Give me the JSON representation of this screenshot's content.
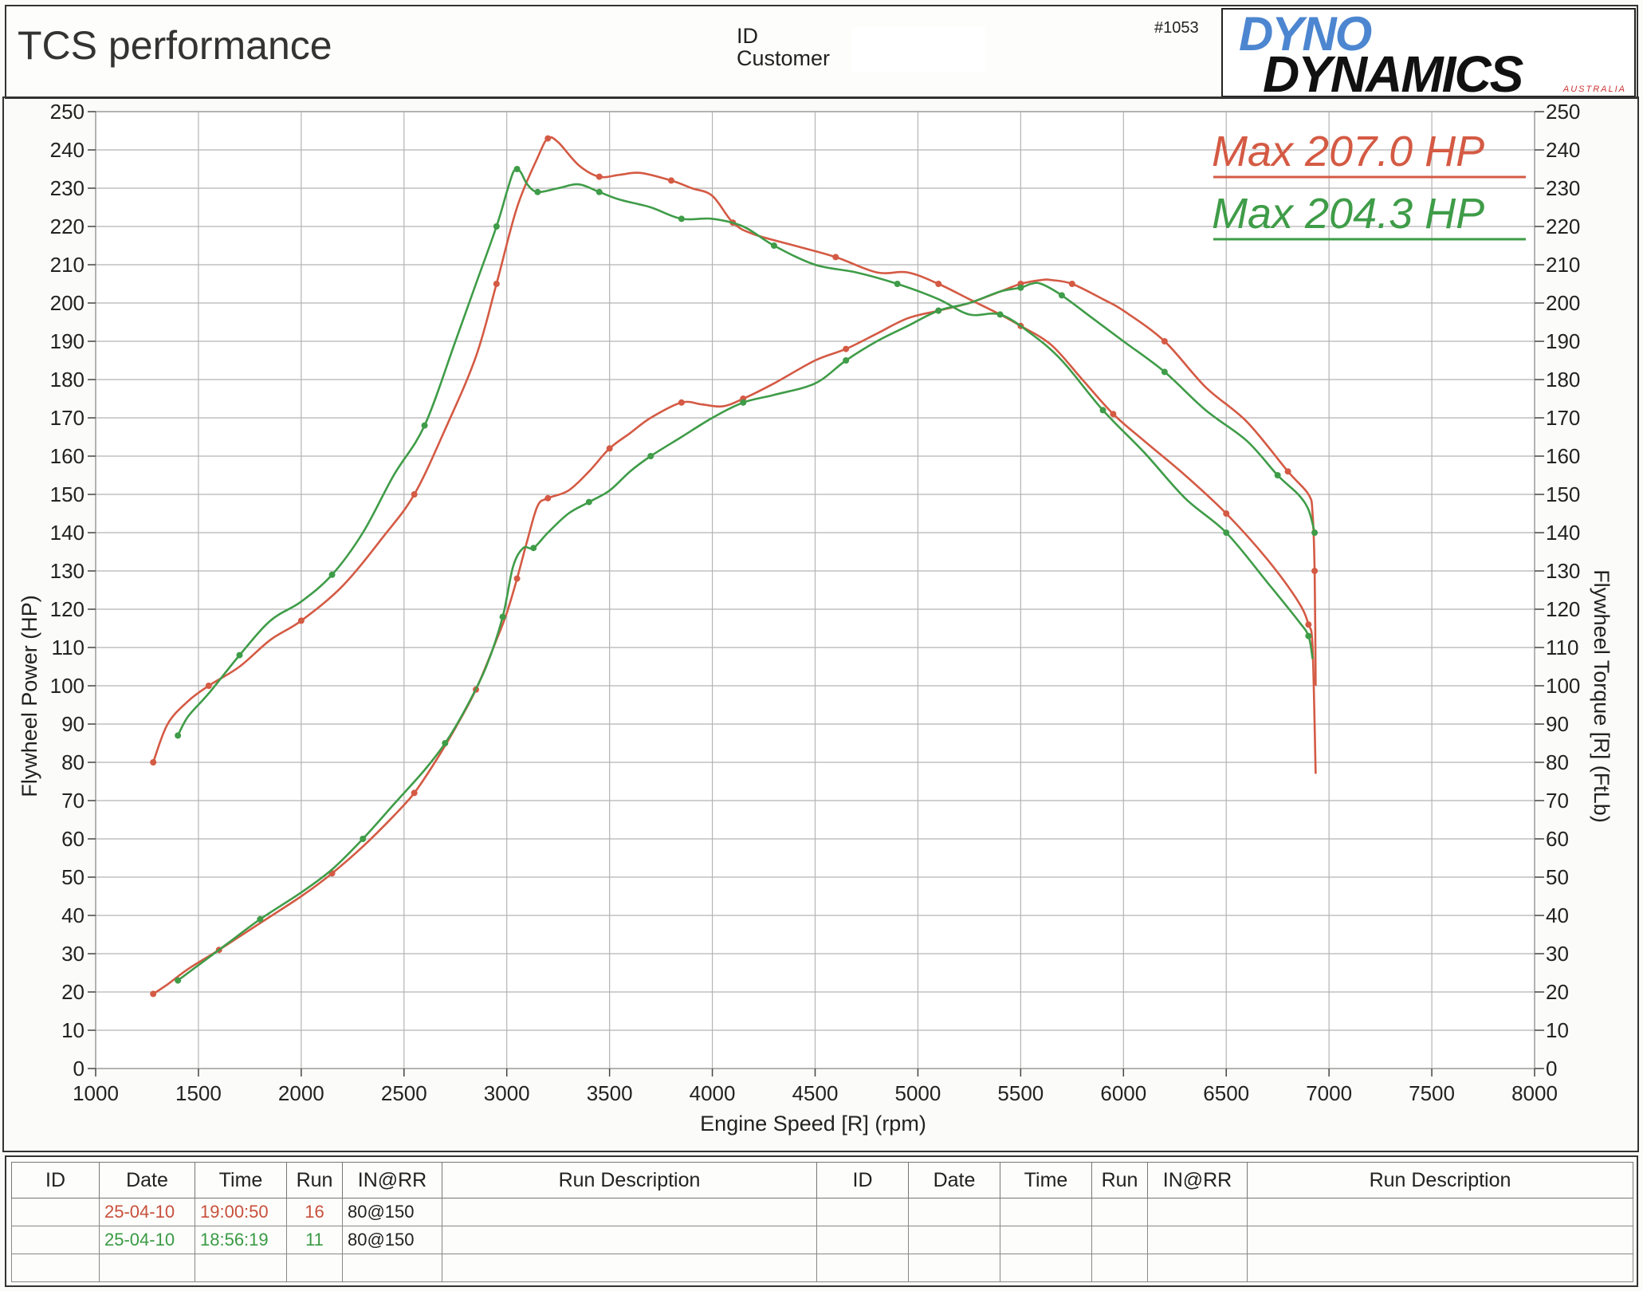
{
  "header": {
    "company": "TCS performance",
    "id_label": "ID",
    "customer_label": "Customer",
    "report_number": "#1053",
    "logo_top": "DYNO",
    "logo_bottom": "DYNAMICS",
    "logo_sub": "AUSTRALIA"
  },
  "colors": {
    "run_red": "#d45a44",
    "run_green": "#3f9c48",
    "grid": "#b4b4b4",
    "axis": "#444444"
  },
  "chart_data": {
    "type": "line",
    "xlabel": "Engine Speed [R] (rpm)",
    "ylabel_left": "Flywheel Power (HP)",
    "ylabel_right": "Flywheel Torque [R] (FtLb)",
    "xlim": [
      1000,
      8000
    ],
    "ylim": [
      0,
      250
    ],
    "x_ticks": [
      1000,
      1500,
      2000,
      2500,
      3000,
      3500,
      4000,
      4500,
      5000,
      5500,
      6000,
      6500,
      7000,
      7500,
      8000
    ],
    "y_ticks": [
      0,
      10,
      20,
      30,
      40,
      50,
      60,
      70,
      80,
      90,
      100,
      110,
      120,
      130,
      140,
      150,
      160,
      170,
      180,
      190,
      200,
      210,
      220,
      230,
      240,
      250
    ],
    "grid": true,
    "annotations": [
      {
        "text": "Max 207.0 HP",
        "color": "#d45a44"
      },
      {
        "text": "Max 204.3 HP",
        "color": "#3f9c48"
      }
    ],
    "series": [
      {
        "run": 16,
        "color": "#d45a44",
        "measure": "power",
        "x": [
          1280,
          1350,
          1450,
          1600,
          1800,
          2000,
          2150,
          2300,
          2450,
          2550,
          2650,
          2750,
          2850,
          2950,
          3000,
          3050,
          3100,
          3150,
          3200,
          3300,
          3400,
          3500,
          3600,
          3700,
          3850,
          3950,
          4050,
          4150,
          4300,
          4500,
          4650,
          4800,
          4950,
          5100,
          5250,
          5400,
          5500,
          5600,
          5650,
          5750,
          5900,
          6000,
          6200,
          6400,
          6600,
          6800,
          6900,
          6920,
          6930,
          6935
        ],
        "y": [
          19.5,
          22,
          26,
          31,
          38,
          45,
          51,
          58,
          66,
          72,
          80,
          89,
          99,
          112,
          119,
          128,
          138,
          147,
          149,
          151,
          156,
          162,
          166,
          170,
          174,
          173.5,
          173,
          175,
          179,
          185,
          188,
          192,
          196,
          198,
          200,
          203,
          205,
          206,
          206,
          205,
          201,
          198,
          190,
          178,
          169,
          156,
          150,
          145,
          130,
          100
        ]
      },
      {
        "run": 16,
        "color": "#d45a44",
        "measure": "torque",
        "x": [
          1280,
          1350,
          1450,
          1550,
          1700,
          1850,
          2000,
          2200,
          2400,
          2550,
          2700,
          2850,
          2950,
          3050,
          3150,
          3200,
          3250,
          3350,
          3450,
          3550,
          3650,
          3800,
          3900,
          4000,
          4100,
          4200,
          4400,
          4600,
          4800,
          4950,
          5100,
          5250,
          5400,
          5500,
          5650,
          5800,
          5950,
          6100,
          6300,
          6500,
          6700,
          6850,
          6900,
          6920,
          6935
        ],
        "y": [
          80,
          90,
          96,
          100,
          105,
          112,
          117,
          126,
          139,
          150,
          167,
          186,
          205,
          225,
          238,
          243,
          242,
          236,
          233,
          233.5,
          234,
          232,
          230,
          228,
          221,
          218,
          215,
          212,
          208,
          208,
          205,
          201,
          197,
          194,
          189,
          180,
          171,
          164,
          155,
          145,
          133,
          122,
          116,
          110,
          77
        ]
      },
      {
        "run": 11,
        "color": "#3f9c48",
        "measure": "power",
        "x": [
          1400,
          1500,
          1650,
          1800,
          2000,
          2150,
          2300,
          2450,
          2600,
          2700,
          2800,
          2900,
          2980,
          3030,
          3080,
          3130,
          3200,
          3300,
          3400,
          3500,
          3600,
          3700,
          3850,
          4000,
          4150,
          4300,
          4500,
          4650,
          4800,
          4950,
          5100,
          5250,
          5400,
          5500,
          5550,
          5600,
          5700,
          5850,
          6000,
          6200,
          6400,
          6600,
          6750,
          6850,
          6900,
          6930
        ],
        "y": [
          23,
          27,
          33,
          39,
          46,
          52,
          60,
          69,
          78,
          85,
          94,
          105,
          118,
          131,
          136,
          136,
          140,
          145,
          148,
          151,
          156,
          160,
          165,
          170,
          174,
          176,
          179,
          185,
          190,
          194,
          198,
          200,
          203,
          204,
          205,
          205,
          202,
          196,
          190,
          182,
          172,
          164,
          155,
          150,
          146,
          140
        ]
      },
      {
        "run": 11,
        "color": "#3f9c48",
        "measure": "torque",
        "x": [
          1400,
          1450,
          1550,
          1700,
          1850,
          2000,
          2150,
          2300,
          2450,
          2600,
          2750,
          2850,
          2950,
          3000,
          3030,
          3050,
          3070,
          3100,
          3150,
          3250,
          3350,
          3450,
          3550,
          3700,
          3850,
          4000,
          4150,
          4300,
          4500,
          4700,
          4900,
          5100,
          5250,
          5400,
          5550,
          5700,
          5900,
          6100,
          6300,
          6500,
          6700,
          6850,
          6900,
          6920
        ],
        "y": [
          87,
          92,
          98,
          108,
          117,
          122,
          129,
          140,
          155,
          168,
          190,
          205,
          220,
          229,
          234,
          235,
          234,
          231,
          229,
          230,
          231,
          229,
          227,
          225,
          222,
          222,
          220,
          215,
          210,
          208,
          205,
          201,
          197,
          197,
          192,
          185,
          172,
          161,
          149,
          140,
          127,
          117,
          113,
          107
        ]
      }
    ]
  },
  "table": {
    "headers": [
      "ID",
      "Date",
      "Time",
      "Run",
      "IN@RR",
      "Run Description",
      "ID",
      "Date",
      "Time",
      "Run",
      "IN@RR",
      "Run Description"
    ],
    "rows": [
      {
        "id": "",
        "date": "25-04-10",
        "time": "19:00:50",
        "run": "16",
        "inrr": "80@150",
        "desc": ""
      },
      {
        "id": "",
        "date": "25-04-10",
        "time": "18:56:19",
        "run": "11",
        "inrr": "80@150",
        "desc": ""
      }
    ]
  }
}
